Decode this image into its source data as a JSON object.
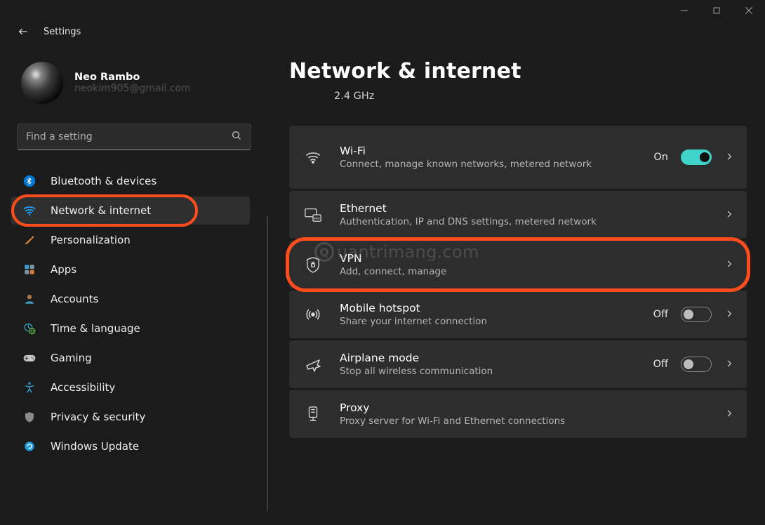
{
  "app_title": "Settings",
  "profile": {
    "name": "Neo Rambo",
    "email": "neokim905@gmail.com"
  },
  "search": {
    "placeholder": "Find a setting"
  },
  "sidebar": {
    "items": [
      {
        "label": "Bluetooth & devices"
      },
      {
        "label": "Network & internet",
        "active": true
      },
      {
        "label": "Personalization"
      },
      {
        "label": "Apps"
      },
      {
        "label": "Accounts"
      },
      {
        "label": "Time & language"
      },
      {
        "label": "Gaming"
      },
      {
        "label": "Accessibility"
      },
      {
        "label": "Privacy & security"
      },
      {
        "label": "Windows Update"
      }
    ]
  },
  "page": {
    "title": "Network & internet",
    "frequency": "2.4 GHz",
    "cards": {
      "wifi": {
        "title": "Wi-Fi",
        "sub": "Connect, manage known networks, metered network",
        "state": "On"
      },
      "ethernet": {
        "title": "Ethernet",
        "sub": "Authentication, IP and DNS settings, metered network"
      },
      "vpn": {
        "title": "VPN",
        "sub": "Add, connect, manage"
      },
      "hotspot": {
        "title": "Mobile hotspot",
        "sub": "Share your internet connection",
        "state": "Off"
      },
      "airplane": {
        "title": "Airplane mode",
        "sub": "Stop all wireless communication",
        "state": "Off"
      },
      "proxy": {
        "title": "Proxy",
        "sub": "Proxy server for Wi-Fi and Ethernet connections"
      }
    }
  },
  "watermark": "uantrimang.com"
}
